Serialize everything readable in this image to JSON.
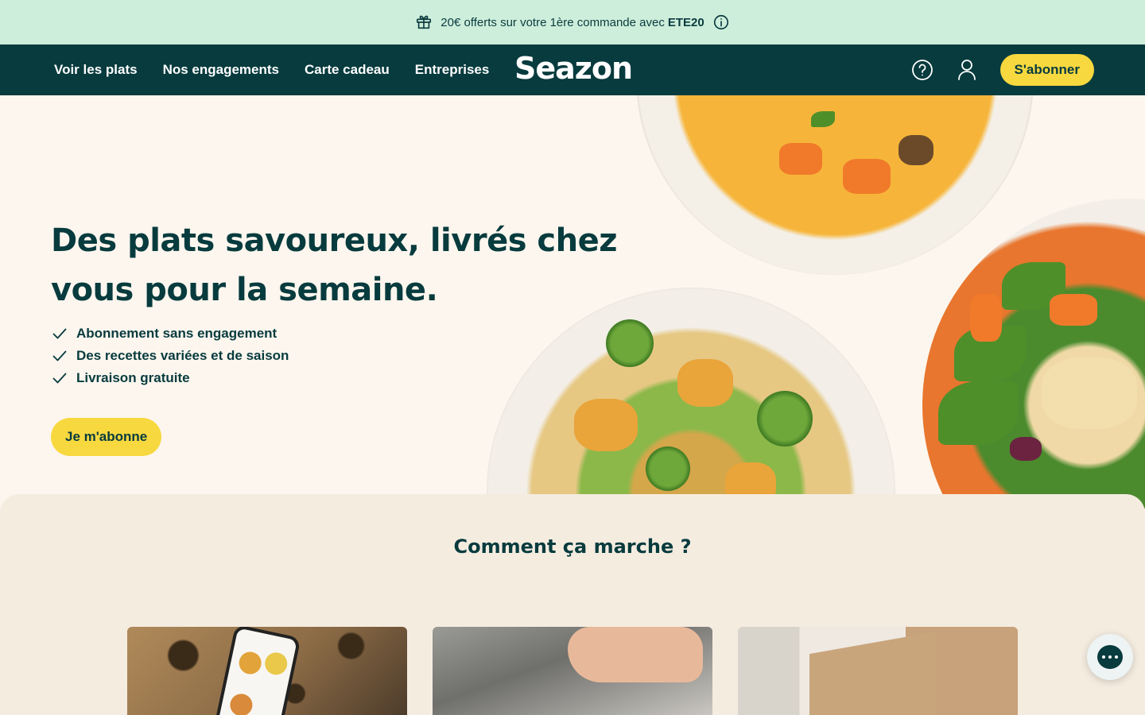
{
  "promo": {
    "text": "20€ offerts sur votre 1ère commande avec",
    "code": "ETE20",
    "icons": [
      "gift-icon",
      "info-icon"
    ],
    "background_color": "#cdeedb"
  },
  "nav": {
    "links": [
      "Voir les plats",
      "Nos engagements",
      "Carte cadeau",
      "Entreprises"
    ],
    "logo": "Seazon",
    "icons": [
      "help-icon",
      "account-icon"
    ],
    "subscribe_label": "S'abonner",
    "background_color": "#073b3e"
  },
  "hero": {
    "title": "Des plats savoureux, livrés chez vous pour la semaine.",
    "benefits": [
      "Abonnement sans engagement",
      "Des recettes variées et de saison",
      "Livraison gratuite"
    ],
    "cta_label": "Je m'abonne"
  },
  "how_it_works": {
    "title": "Comment ça marche ?"
  },
  "chat": {
    "icon": "chat-icon"
  },
  "colors": {
    "accent_yellow": "#f7d83f",
    "brand_dark": "#073b3e",
    "page_background": "#fcf6ee",
    "section_background": "#f5ece0"
  }
}
